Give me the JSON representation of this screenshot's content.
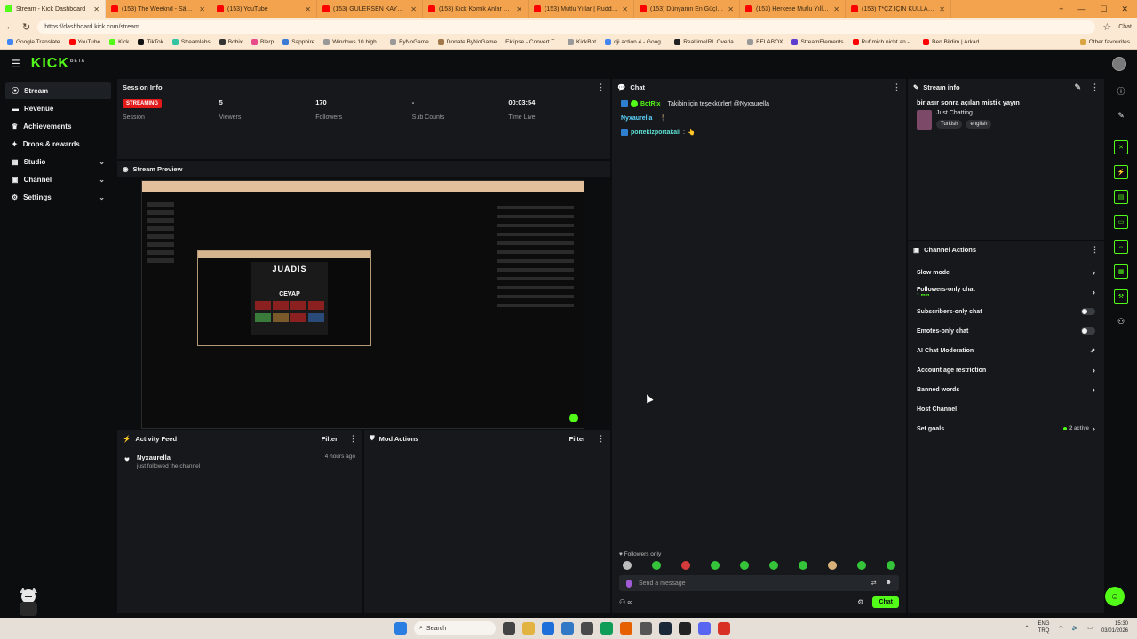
{
  "browser": {
    "tabs": [
      {
        "label": "Stream - Kick Dashboard",
        "color": "#53fc18",
        "active": true
      },
      {
        "label": "(153) The Weeknd - São Paulo",
        "color": "#ff0000"
      },
      {
        "label": "(153) YouTube",
        "color": "#ff0000"
      },
      {
        "label": "(153) GÜLERSEN KAYBEDERSİN 20",
        "color": "#ff0000"
      },
      {
        "label": "(153) Kick Komik Anlar Türkiye Re",
        "color": "#ff0000"
      },
      {
        "label": "(153) Mutlu Yıllar | Ruddy - YouTu",
        "color": "#ff0000"
      },
      {
        "label": "(153) Dünyanın En Güçlü Üniversi",
        "color": "#ff0000"
      },
      {
        "label": "(153) Herkese Mutlu Yıllar 🎉 202",
        "color": "#ff0000"
      },
      {
        "label": "(153) T*ÇZ İÇİN KULLANILAN YA",
        "color": "#ff0000"
      }
    ],
    "chat_label": "Chat",
    "url": "https://dashboard.kick.com/stream",
    "bookmarks": [
      "Google Translate",
      "YouTube",
      "Kick",
      "TikTok",
      "Streamlabs",
      "Bobix",
      "Blerp",
      "Sapphire",
      "Windows 10 high...",
      "ByNoGame",
      "Donate ByNoGame",
      "Eklipse - Convert T...",
      "KickBot",
      "dji action 4 - Goog...",
      "RealtimeIRL Overla...",
      "BELABOX",
      "StreamElements",
      "Ruf mich nicht an -...",
      "Ben Bildim | Arkad..."
    ],
    "other_favorites": "Other favourites"
  },
  "app": {
    "logo": "KICK",
    "logo_sup": "BETA"
  },
  "sidebar": {
    "items": [
      {
        "label": "Stream",
        "active": true,
        "expandable": false
      },
      {
        "label": "Revenue",
        "expandable": false
      },
      {
        "label": "Achievements",
        "expandable": false
      },
      {
        "label": "Drops & rewards",
        "expandable": false
      },
      {
        "label": "Studio",
        "expandable": true
      },
      {
        "label": "Channel",
        "expandable": true
      },
      {
        "label": "Settings",
        "expandable": true
      }
    ]
  },
  "session_info": {
    "title": "Session Info",
    "status_badge": "STREAMING",
    "session_label": "Session",
    "stats": [
      {
        "value": "5",
        "label": "Viewers"
      },
      {
        "value": "170",
        "label": "Followers"
      },
      {
        "value": "-",
        "label": "Sub Counts"
      },
      {
        "value": "00:03:54",
        "label": "Time Live"
      }
    ]
  },
  "stream_preview": {
    "title": "Stream Preview",
    "game_title": "JUADIS",
    "game_caption": "CEVAP"
  },
  "activity_feed": {
    "title": "Activity Feed",
    "filter_label": "Filter",
    "items": [
      {
        "name": "Nyxaurella",
        "action": "just followed the channel",
        "time": "4 hours ago"
      }
    ]
  },
  "mod_actions": {
    "title": "Mod Actions",
    "filter_label": "Filter"
  },
  "chat": {
    "title": "Chat",
    "messages": [
      {
        "user": "BotRix",
        "text": "Takibin için teşekkürler! @Nyxaurella",
        "style": "u1"
      },
      {
        "user": "Nyxaurella",
        "text": "",
        "style": "u2"
      },
      {
        "user": "portekizportakali",
        "text": "",
        "style": "u3"
      }
    ],
    "followers_only": "Followers only",
    "input_placeholder": "Send a message",
    "send_label": "Chat"
  },
  "stream_info": {
    "title": "Stream info",
    "stream_title": "bir asır sonra açılan mistik yayın",
    "category": "Just Chatting",
    "tags": [
      "Turkish",
      "english"
    ]
  },
  "channel_actions": {
    "title": "Channel Actions",
    "items": [
      {
        "label": "Slow mode",
        "control": "chevron"
      },
      {
        "label": "Followers-only chat",
        "sub": "1 min",
        "control": "chevron"
      },
      {
        "label": "Subscribers-only chat",
        "control": "toggle"
      },
      {
        "label": "Emotes-only chat",
        "control": "toggle"
      },
      {
        "label": "AI Chat Moderation",
        "control": "external"
      },
      {
        "label": "Account age restriction",
        "control": "chevron"
      },
      {
        "label": "Banned words",
        "control": "chevron"
      },
      {
        "label": "Host Channel",
        "control": "none"
      },
      {
        "label": "Set goals",
        "control": "goals",
        "goal_text": "2 active"
      }
    ]
  },
  "taskbar": {
    "search_label": "Search",
    "lang_top": "ENG",
    "lang_bottom": "TRQ",
    "time": "15:30",
    "date": "03/01/2026"
  },
  "colors": {
    "brand_green": "#53fc18",
    "live_red": "#e21a1a",
    "panel_bg": "#16181b",
    "page_bg": "#0b0d0f"
  }
}
